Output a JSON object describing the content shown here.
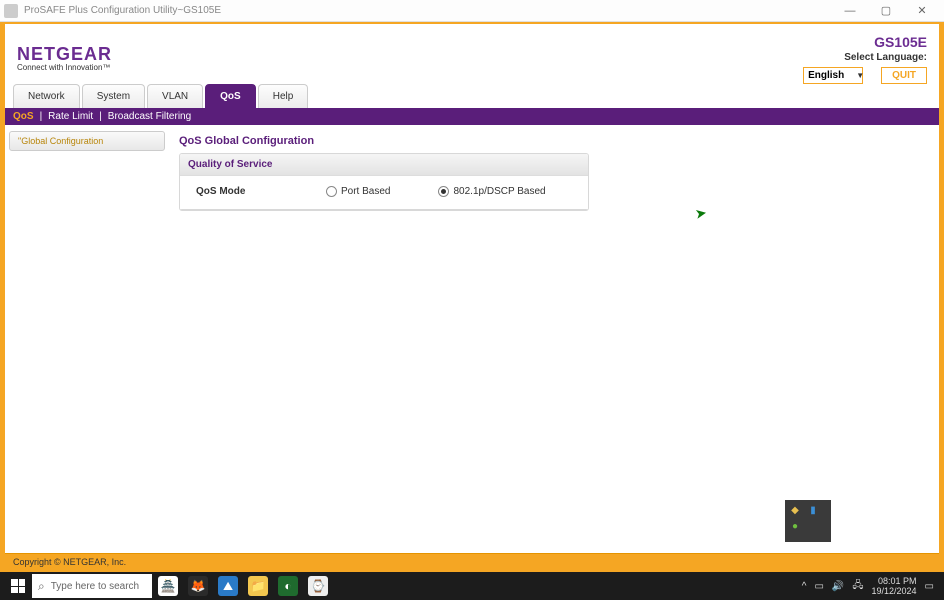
{
  "titlebar": {
    "text": "ProSAFE Plus Configuration Utility~GS105E"
  },
  "brand": {
    "logo": "NETGEAR",
    "tagline": "Connect with Innovation™",
    "model": "GS105E"
  },
  "language": {
    "label": "Select Language:",
    "value": "English"
  },
  "buttons": {
    "quit": "QUIT"
  },
  "tabs": {
    "main": [
      "Network",
      "System",
      "VLAN",
      "QoS",
      "Help"
    ],
    "main_active": "QoS",
    "sub": [
      "QoS",
      "Rate Limit",
      "Broadcast Filtering"
    ],
    "sub_active": "QoS"
  },
  "sidebar": {
    "items": [
      "\"Global Configuration"
    ]
  },
  "page": {
    "title": "QoS Global Configuration",
    "panel_title": "Quality of Service",
    "field_label": "QoS Mode",
    "options": {
      "port": "Port Based",
      "dscp": "802.1p/DSCP Based"
    },
    "selected": "dscp"
  },
  "footer": {
    "copyright": "Copyright © NETGEAR, Inc."
  },
  "taskbar": {
    "search_placeholder": "Type here to search",
    "time": "08:01 PM",
    "date": "19/12/2024"
  }
}
